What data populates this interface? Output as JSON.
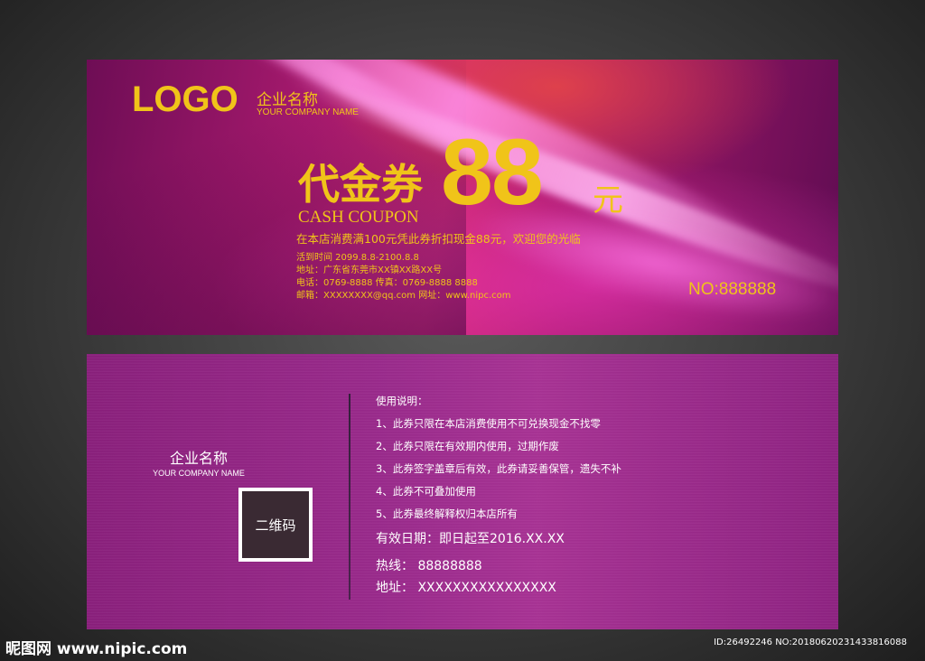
{
  "front": {
    "logo_text": "LOGO",
    "company_cn": "企业名称",
    "company_en": "YOUR COMPANY NAME",
    "coupon_cn": "代金券",
    "coupon_amount": "88",
    "coupon_unit": "元",
    "coupon_en": "CASH COUPON",
    "promo_text": "在本店消费满100元凭此券折扣现金88元，欢迎您的光临",
    "event_time": "活到时间  2099.8.8-2100.8.8",
    "address": "地址：广东省东莞市XX镇XX路XX号",
    "phone_fax": "电话：0769-8888  传真：0769-8888 8888",
    "email_web": "邮箱：XXXXXXXX@qq.com     网址：www.nipc.com",
    "serial": "NO:888888"
  },
  "back": {
    "company_cn": "企业名称",
    "company_en": "YOUR COMPANY NAME",
    "qr_label": "二维码",
    "rules_title": "使用说明：",
    "rules": [
      "1、此券只限在本店消费使用不可兑换现金不找零",
      "2、此券只限在有效期内使用，过期作废",
      "3、此券签字盖章后有效，此券请妥善保管，遗失不补",
      "4、此券不可叠加使用",
      "5、此券最终解释权归本店所有"
    ],
    "validity": "有效日期：即日起至2016.XX.XX",
    "hotline": "热线：  88888888",
    "address": "地址：  XXXXXXXXXXXXXXXX"
  },
  "watermark": {
    "left": "昵图网 www.nipic.com",
    "right": "ID:26492246 NO:20180620231433816088"
  },
  "colors": {
    "gold": "#f0c419",
    "front_magenta": "#a81a6e",
    "back_purple": "#9a2a8c",
    "qr_fill": "#3a2a33"
  }
}
